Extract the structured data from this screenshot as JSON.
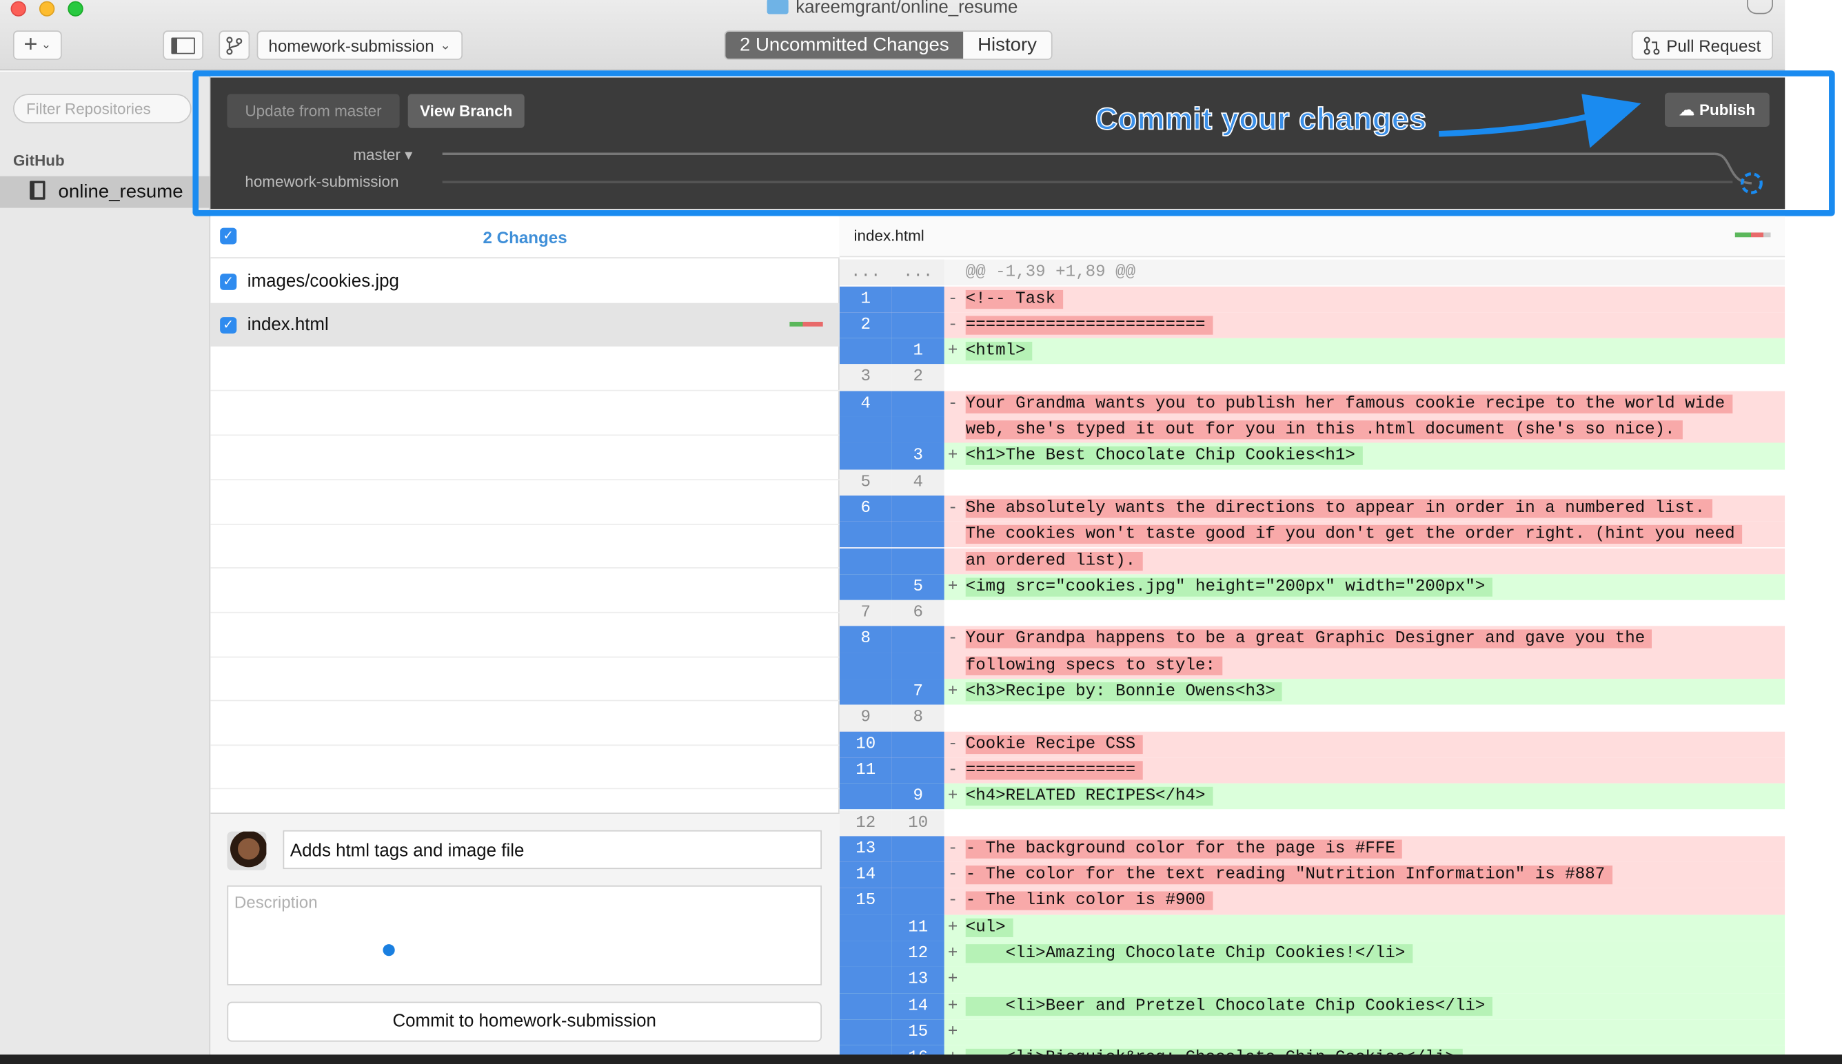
{
  "window": {
    "title": "kareemgrant/online_resume",
    "branch_selector": "homework-submission",
    "tabs": [
      {
        "label": "2 Uncommitted Changes",
        "active": true
      },
      {
        "label": "History",
        "active": false
      }
    ],
    "pull_request_label": "Pull Request"
  },
  "sidebar": {
    "filter_placeholder": "Filter Repositories",
    "section_label": "GitHub",
    "repo": "online_resume"
  },
  "branchbar": {
    "update_label": "Update from master",
    "view_branch_label": "View Branch",
    "publish_label": "Publish",
    "base_branch": "master ▾",
    "current_branch": "homework-submission"
  },
  "annotation": {
    "text": "Commit  your changes",
    "color": "#1a8bf0"
  },
  "changes": {
    "header": "2 Changes",
    "files": [
      {
        "name": "images/cookies.jpg",
        "selected": false
      },
      {
        "name": "index.html",
        "selected": true
      }
    ]
  },
  "commit": {
    "summary": "Adds html tags and image file",
    "description_placeholder": "Description",
    "button_label": "Commit to homework-submission"
  },
  "diff": {
    "filename": "index.html",
    "hunk_header": "@@ -1,39 +1,89 @@",
    "lines": [
      {
        "t": "del",
        "o": "1",
        "n": "",
        "s": "-",
        "x": "<!-- Task"
      },
      {
        "t": "del",
        "o": "2",
        "n": "",
        "s": "-",
        "x": "========================"
      },
      {
        "t": "add",
        "o": "",
        "n": "1",
        "s": "+",
        "x": "<html>"
      },
      {
        "t": "ctx",
        "o": "3",
        "n": "2",
        "s": "",
        "x": ""
      },
      {
        "t": "del",
        "o": "4",
        "n": "",
        "s": "-",
        "x": "Your Grandma wants you to publish her famous cookie recipe to the world wide"
      },
      {
        "t": "del",
        "o": "",
        "n": "",
        "s": "",
        "x": "web, she's typed it out for you in this .html document (she's so nice)."
      },
      {
        "t": "add",
        "o": "",
        "n": "3",
        "s": "+",
        "x": "<h1>The Best Chocolate Chip Cookies<h1>"
      },
      {
        "t": "ctx",
        "o": "5",
        "n": "4",
        "s": "",
        "x": ""
      },
      {
        "t": "del",
        "o": "6",
        "n": "",
        "s": "-",
        "x": "She absolutely wants the directions to appear in order in a numbered list."
      },
      {
        "t": "del",
        "o": "",
        "n": "",
        "s": "",
        "x": "The cookies won't taste good if you don't get the order right. (hint you need"
      },
      {
        "t": "del",
        "o": "",
        "n": "",
        "s": "",
        "x": "an ordered list)."
      },
      {
        "t": "add",
        "o": "",
        "n": "5",
        "s": "+",
        "x": "<img src=\"cookies.jpg\" height=\"200px\" width=\"200px\">"
      },
      {
        "t": "ctx",
        "o": "7",
        "n": "6",
        "s": "",
        "x": ""
      },
      {
        "t": "del",
        "o": "8",
        "n": "",
        "s": "-",
        "x": "Your Grandpa happens to be a great Graphic Designer and gave you the"
      },
      {
        "t": "del",
        "o": "",
        "n": "",
        "s": "",
        "x": "following specs to style:"
      },
      {
        "t": "add",
        "o": "",
        "n": "7",
        "s": "+",
        "x": "<h3>Recipe by: Bonnie Owens<h3>"
      },
      {
        "t": "ctx",
        "o": "9",
        "n": "8",
        "s": "",
        "x": ""
      },
      {
        "t": "del",
        "o": "10",
        "n": "",
        "s": "-",
        "x": "Cookie Recipe CSS"
      },
      {
        "t": "del",
        "o": "11",
        "n": "",
        "s": "-",
        "x": "================="
      },
      {
        "t": "add",
        "o": "",
        "n": "9",
        "s": "+",
        "x": "<h4>RELATED RECIPES</h4>"
      },
      {
        "t": "ctx",
        "o": "12",
        "n": "10",
        "s": "",
        "x": ""
      },
      {
        "t": "del",
        "o": "13",
        "n": "",
        "s": "-",
        "x": "- The background color for the page is #FFE"
      },
      {
        "t": "del",
        "o": "14",
        "n": "",
        "s": "-",
        "x": "- The color for the text reading \"Nutrition Information\" is #887"
      },
      {
        "t": "del",
        "o": "15",
        "n": "",
        "s": "-",
        "x": "- The link color is #900"
      },
      {
        "t": "add",
        "o": "",
        "n": "11",
        "s": "+",
        "x": "<ul>"
      },
      {
        "t": "add",
        "o": "",
        "n": "12",
        "s": "+",
        "x": "    <li>Amazing Chocolate Chip Cookies!</li>"
      },
      {
        "t": "add",
        "o": "",
        "n": "13",
        "s": "+",
        "x": ""
      },
      {
        "t": "add",
        "o": "",
        "n": "14",
        "s": "+",
        "x": "    <li>Beer and Pretzel Chocolate Chip Cookies</li>"
      },
      {
        "t": "add",
        "o": "",
        "n": "15",
        "s": "+",
        "x": ""
      },
      {
        "t": "add",
        "o": "",
        "n": "16",
        "s": "+",
        "x": "    <li>Bisquick&reg; Chocolate Chip Cookies</li>"
      }
    ]
  }
}
